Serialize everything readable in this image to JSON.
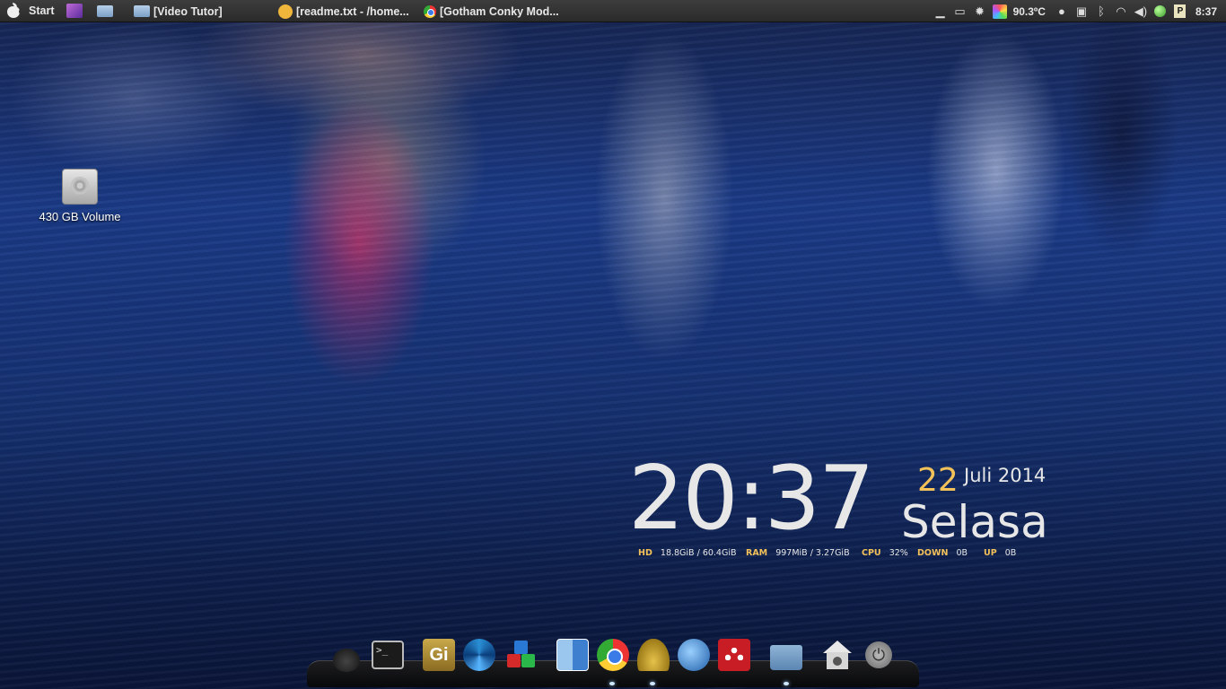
{
  "top_panel": {
    "start_label": "Start",
    "tasks": [
      {
        "label": "[Video Tutor]",
        "icon": "folder-icon"
      },
      {
        "label": "[readme.txt - /home...",
        "icon": "text-editor-icon"
      },
      {
        "label": "[Gotham Conky Mod...",
        "icon": "chrome-icon"
      }
    ],
    "tray": {
      "temperature": "90.3ºC",
      "clock": "8:37"
    }
  },
  "desktop": {
    "icons": [
      {
        "label": "430 GB Volume",
        "icon": "hard-drive-icon"
      }
    ]
  },
  "conky": {
    "time": "20:37",
    "day": "22",
    "month_year": "Juli 2014",
    "weekday": "Selasa",
    "stats": {
      "hd_label": "HD",
      "hd_value": "18.8GiB / 60.4GiB",
      "ram_label": "RAM",
      "ram_value": "997MiB / 3.27GiB",
      "cpu_label": "CPU",
      "cpu_value": "32%",
      "down_label": "DOWN",
      "down_value": "0B",
      "up_label": "UP",
      "up_value": "0B"
    },
    "colors": {
      "accent": "#f3c15a",
      "text": "#e7e7e7"
    }
  },
  "dock": {
    "items": [
      {
        "name": "dark-orb-icon"
      },
      {
        "name": "terminal-icon",
        "glyph": ">_"
      },
      {
        "name": "gimp-icon",
        "glyph": "Gi"
      },
      {
        "name": "spiral-icon"
      },
      {
        "name": "cubes-icon"
      },
      {
        "name": "finder-icon"
      },
      {
        "name": "chrome-icon"
      },
      {
        "name": "genie-lamp-icon"
      },
      {
        "name": "thunderbird-icon"
      },
      {
        "name": "mendeley-icon"
      },
      {
        "name": "folder-icon"
      },
      {
        "name": "home-icon"
      },
      {
        "name": "power-icon"
      }
    ]
  }
}
